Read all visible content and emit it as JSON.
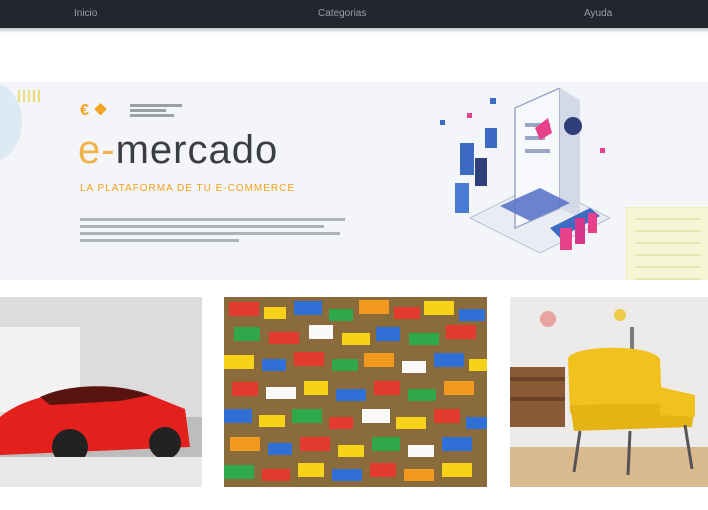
{
  "topnav": {
    "items": [
      "Inicio",
      "Categorias",
      "Ayuda"
    ]
  },
  "hero": {
    "brand_prefix": "e-",
    "brand_name": "mercado",
    "tagline": "LA PLATAFORMA DE TU E-COMMERCE",
    "logo_mark": "€ ❖"
  },
  "cards": [
    {
      "subject": "red sports car"
    },
    {
      "subject": "colorful toy bricks"
    },
    {
      "subject": "yellow armchair"
    }
  ],
  "colors": {
    "accent": "#f2a21b",
    "topbar": "#23262c",
    "banner": "#f4f5f8"
  }
}
